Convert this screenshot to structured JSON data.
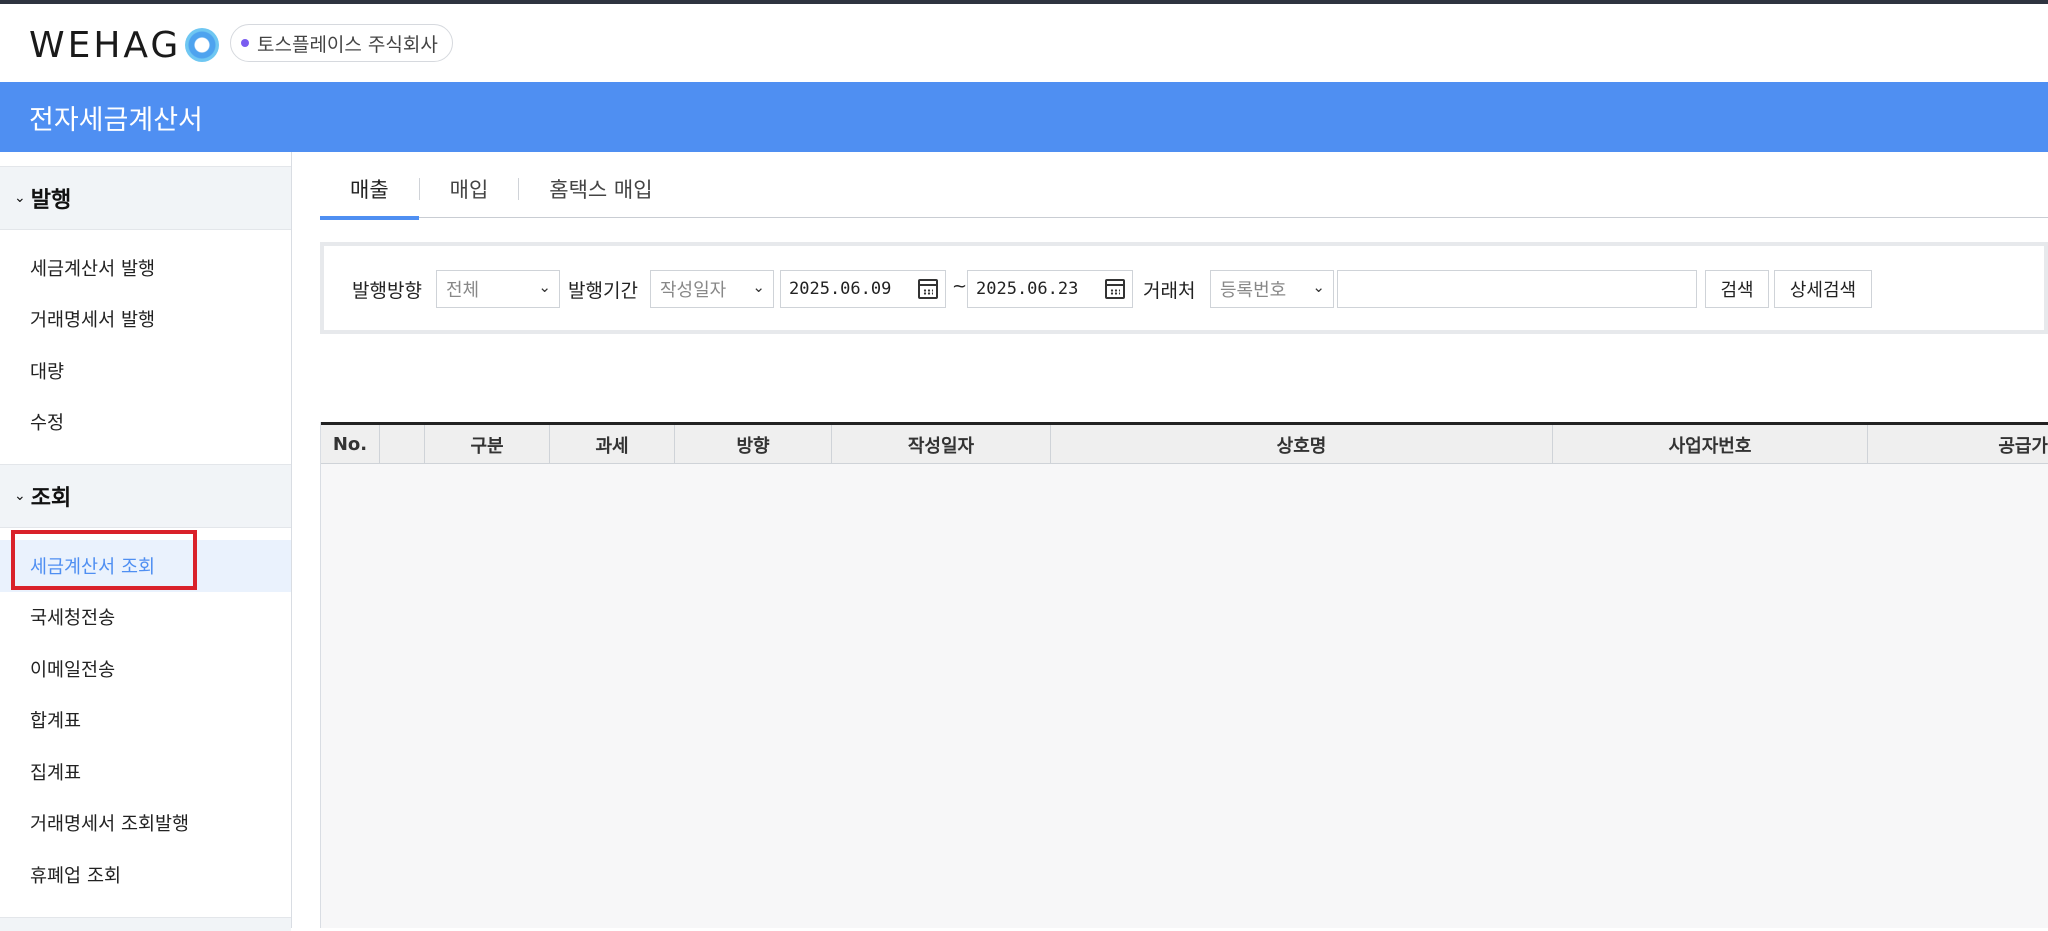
{
  "app": {
    "logo_text": "WEHAG",
    "company": "토스플레이스 주식회사",
    "title": "전자세금계산서"
  },
  "sidebar": {
    "sections": [
      {
        "label": "발행",
        "items": [
          "세금계산서 발행",
          "거래명세서 발행",
          "대량",
          "수정"
        ]
      },
      {
        "label": "조회",
        "items": [
          "세금계산서 조회",
          "국세청전송",
          "이메일전송",
          "합계표",
          "집계표",
          "거래명세서 조회발행",
          "휴폐업 조회"
        ]
      }
    ],
    "active_item": "세금계산서 조회"
  },
  "tabs": [
    "매출",
    "매입",
    "홈택스 매입"
  ],
  "active_tab": "매출",
  "filter": {
    "direction_label": "발행방향",
    "direction_value": "전체",
    "period_label": "발행기간",
    "period_type": "작성일자",
    "date_from": "2025.06.09",
    "date_sep": "~",
    "date_to": "2025.06.23",
    "partner_label": "거래처",
    "partner_type": "등록번호",
    "partner_value": "",
    "search_button": "검색",
    "detail_search_button": "상세검색"
  },
  "table": {
    "columns": [
      "No.",
      "",
      "구분",
      "과세",
      "방향",
      "작성일자",
      "상호명",
      "사업자번호",
      "공급가"
    ]
  },
  "colors": {
    "accent": "#4f8ff2",
    "highlight_box": "#d9212a"
  }
}
